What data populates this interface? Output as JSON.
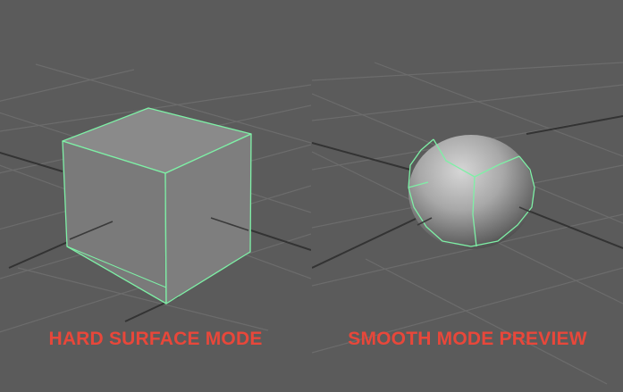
{
  "panels": {
    "left": {
      "label": "HARD SURFACE MODE",
      "object_icon": "cube-wireframe-icon"
    },
    "right": {
      "label": "SMOOTH MODE PREVIEW",
      "object_icon": "sphere-wireframe-icon"
    }
  },
  "colors": {
    "background": "#5b5b5b",
    "grid_line": "#6e6e6e",
    "grid_axis": "#2f2f2f",
    "selection_wire": "#7ef0a6",
    "label": "#e8473a"
  }
}
